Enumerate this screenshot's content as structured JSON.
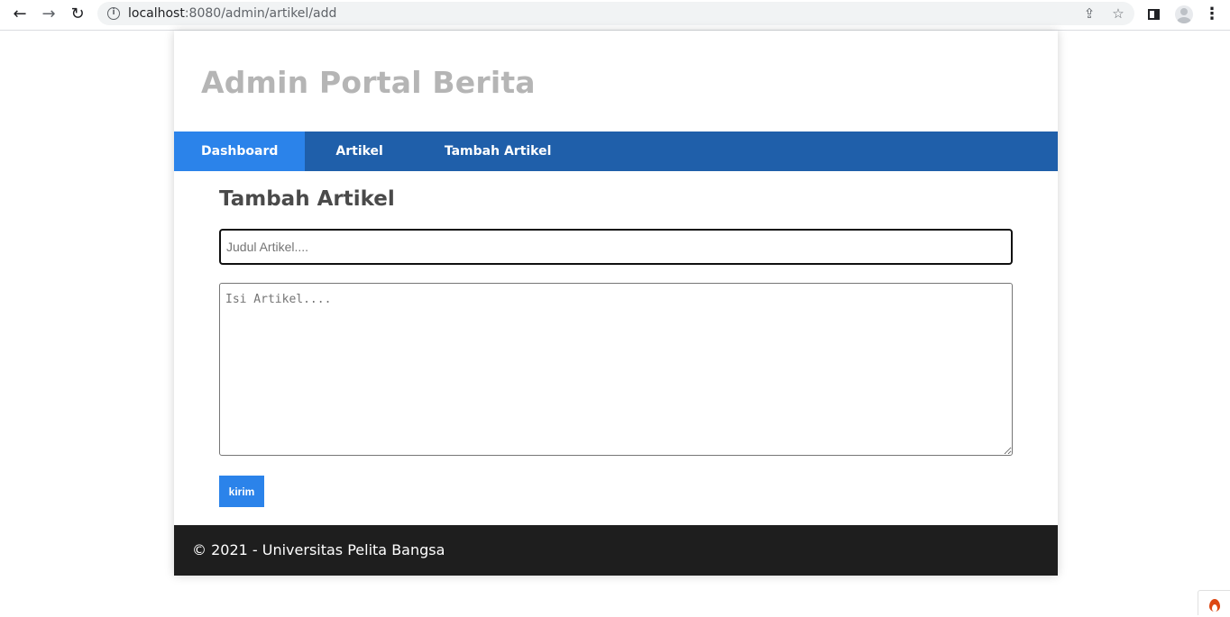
{
  "browser": {
    "url_host": "localhost",
    "url_rest": ":8080/admin/artikel/add"
  },
  "site": {
    "title": "Admin Portal Berita"
  },
  "nav": {
    "items": [
      {
        "label": "Dashboard",
        "active": true
      },
      {
        "label": "Artikel",
        "active": false
      },
      {
        "label": "Tambah Artikel",
        "active": false
      }
    ]
  },
  "form": {
    "heading": "Tambah Artikel",
    "title_placeholder": "Judul Artikel....",
    "title_value": "",
    "body_placeholder": "Isi Artikel....",
    "body_value": "",
    "submit_label": "kirim"
  },
  "footer": {
    "text": "© 2021 - Universitas Pelita Bangsa"
  },
  "colors": {
    "nav_bg": "#1f5faa",
    "nav_active": "#2b83ea",
    "button": "#2b83ea",
    "footer_bg": "#1e1e1e",
    "title_grey": "#b5b5b5"
  }
}
